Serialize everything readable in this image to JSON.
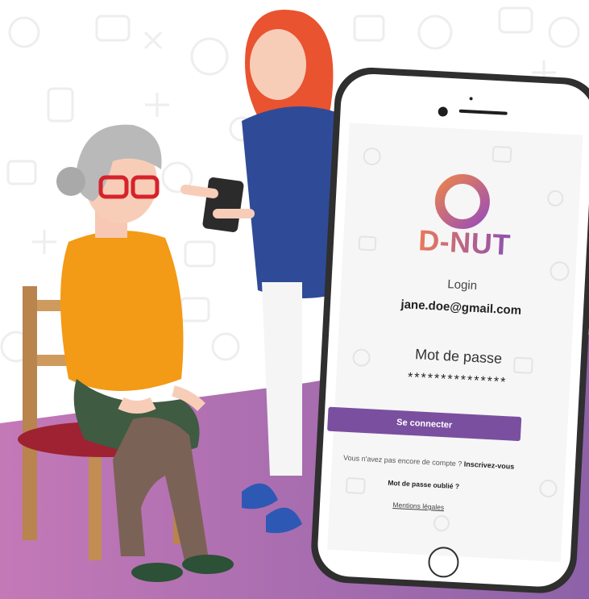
{
  "app": {
    "brand": "D-NUT"
  },
  "login": {
    "label": "Login",
    "email_value": "jane.doe@gmail.com",
    "password_label": "Mot de passe",
    "password_value": "***************",
    "submit_label": "Se connecter",
    "signup_prompt": "Vous n'avez pas encore de compte ?",
    "signup_link": "Inscrivez-vous",
    "forgot_link": "Mot de passe oublié ?",
    "legal_link": "Mentions légales"
  },
  "colors": {
    "accent": "#7b4f9f",
    "brand_orange": "#e97a5a",
    "floor_purple": "#b873b3"
  }
}
